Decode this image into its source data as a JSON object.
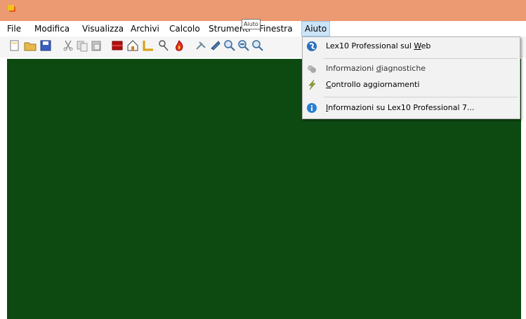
{
  "menubar": {
    "items": [
      "File",
      "Modifica",
      "Visualizza",
      "Archivi",
      "Calcolo",
      "Strumenti",
      "Finestra",
      "Aiuto"
    ]
  },
  "tooltip": "Aiuto",
  "toolbar": {
    "buttons": [
      "new-document-icon",
      "open-folder-icon",
      "save-icon",
      "cut-icon",
      "copy-icon",
      "paste-icon",
      "archive-icon",
      "house-icon",
      "ruler-icon",
      "key-icon",
      "fire-icon",
      "tool-icon",
      "zoom-in-icon",
      "zoom-icon",
      "zoom-out-icon",
      "zoom-fit-icon"
    ]
  },
  "help_menu": {
    "items": [
      {
        "pre": "Lex10 Professional sul ",
        "mn": "W",
        "post": "eb",
        "icon": "globe-icon",
        "enabled": true
      },
      {
        "pre": "Informazioni ",
        "mn": "d",
        "post": "iagnostiche",
        "icon": "diagnostics-icon",
        "enabled": false
      },
      {
        "pre": "",
        "mn": "C",
        "post": "ontrollo aggiornamenti",
        "icon": "lightning-icon",
        "enabled": true
      },
      {
        "pre": "",
        "mn": "I",
        "post": "nformazioni su Lex10 Professional 7...",
        "icon": "info-icon",
        "enabled": true
      }
    ]
  },
  "colors": {
    "titlebar": "#ec9a72",
    "workspace": "#0c4a12",
    "menu_highlight": "#cce4f7"
  }
}
